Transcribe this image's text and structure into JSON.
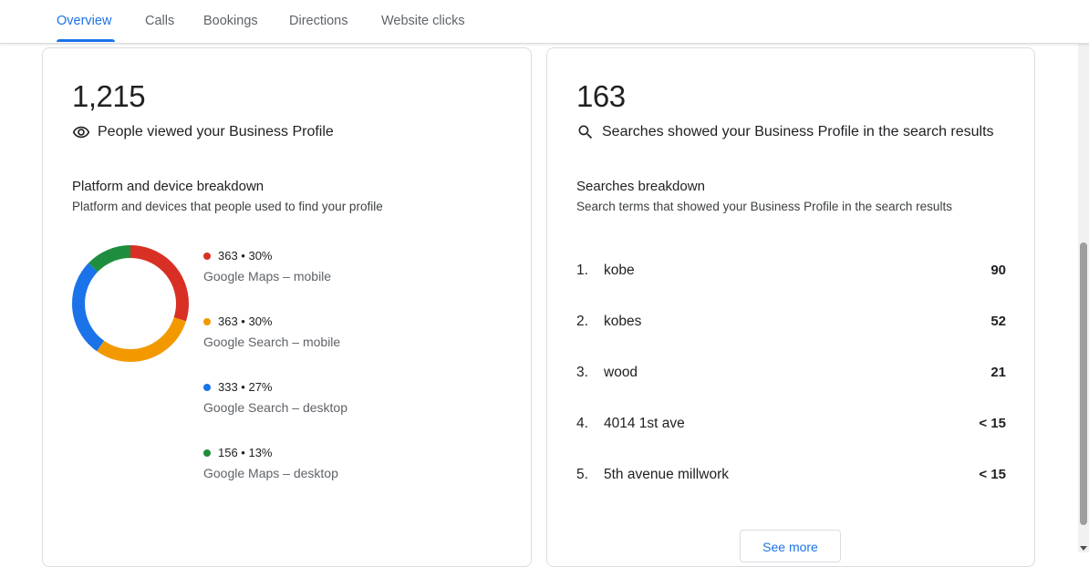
{
  "tabs": [
    {
      "label": "Overview"
    },
    {
      "label": "Calls"
    },
    {
      "label": "Bookings"
    },
    {
      "label": "Directions"
    },
    {
      "label": "Website clicks"
    }
  ],
  "profile_views": {
    "value": "1,215",
    "label": "People viewed your Business Profile",
    "icon": "eye-icon",
    "breakdown_title": "Platform and device breakdown",
    "breakdown_subtitle": "Platform and devices that people used to find your profile",
    "items": [
      {
        "stat": "363 • 30%",
        "label": "Google Maps – mobile",
        "color": "#d93025",
        "value": 363
      },
      {
        "stat": "363 • 30%",
        "label": "Google Search – mobile",
        "color": "#f29900",
        "value": 363
      },
      {
        "stat": "333 • 27%",
        "label": "Google Search – desktop",
        "color": "#1a73e8",
        "value": 333
      },
      {
        "stat": "156 • 13%",
        "label": "Google Maps – desktop",
        "color": "#1e8e3e",
        "value": 156
      }
    ]
  },
  "searches": {
    "value": "163",
    "label": "Searches showed your Business Profile in the search results",
    "icon": "search-icon",
    "breakdown_title": "Searches breakdown",
    "breakdown_subtitle": "Search terms that showed your Business Profile in the search results",
    "rows": [
      {
        "rank": "1.",
        "term": "kobe",
        "count": "90"
      },
      {
        "rank": "2.",
        "term": "kobes",
        "count": "52"
      },
      {
        "rank": "3.",
        "term": "wood",
        "count": "21"
      },
      {
        "rank": "4.",
        "term": "4014 1st ave",
        "count": "< 15"
      },
      {
        "rank": "5.",
        "term": "5th avenue millwork",
        "count": "< 15"
      }
    ],
    "see_more_label": "See more"
  }
}
